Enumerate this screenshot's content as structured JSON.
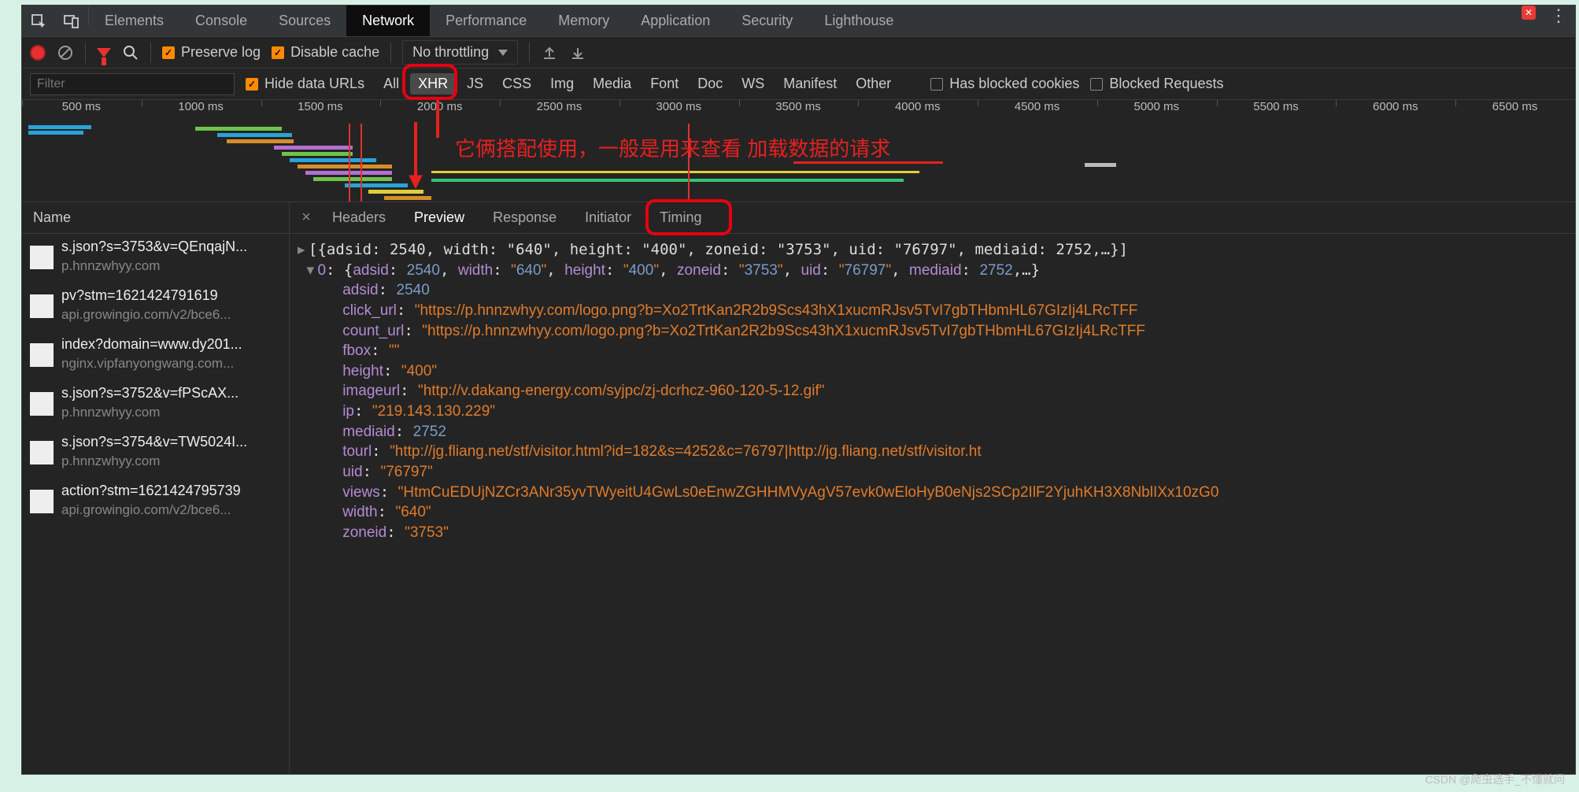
{
  "topTabs": [
    "Elements",
    "Console",
    "Sources",
    "Network",
    "Performance",
    "Memory",
    "Application",
    "Security",
    "Lighthouse"
  ],
  "topActive": "Network",
  "toolbar": {
    "preserve_log": "Preserve log",
    "disable_cache": "Disable cache",
    "throttling": "No throttling"
  },
  "filter": {
    "placeholder": "Filter",
    "hide_data_urls": "Hide data URLs",
    "types": [
      "All",
      "XHR",
      "JS",
      "CSS",
      "Img",
      "Media",
      "Font",
      "Doc",
      "WS",
      "Manifest",
      "Other"
    ],
    "selected_type": "XHR",
    "blocked_cookies": "Has blocked cookies",
    "blocked_requests": "Blocked Requests"
  },
  "timeline_marks": [
    "500 ms",
    "1000 ms",
    "1500 ms",
    "2000 ms",
    "2500 ms",
    "3000 ms",
    "3500 ms",
    "4000 ms",
    "4500 ms",
    "5000 ms",
    "5500 ms",
    "6000 ms",
    "6500 ms"
  ],
  "annotation": "它俩搭配使用，一般是用来查看    加载数据的请求",
  "left_header": "Name",
  "requests": [
    {
      "name": "s.json?s=3753&v=QEnqajN...",
      "host": "p.hnnzwhyy.com"
    },
    {
      "name": "pv?stm=1621424791619",
      "host": "api.growingio.com/v2/bce6..."
    },
    {
      "name": "index?domain=www.dy201...",
      "host": "nginx.vipfanyongwang.com..."
    },
    {
      "name": "s.json?s=3752&v=fPScAX...",
      "host": "p.hnnzwhyy.com"
    },
    {
      "name": "s.json?s=3754&v=TW5024I...",
      "host": "p.hnnzwhyy.com"
    },
    {
      "name": "action?stm=1621424795739",
      "host": "api.growingio.com/v2/bce6..."
    }
  ],
  "detailTabs": [
    "Headers",
    "Preview",
    "Response",
    "Initiator",
    "Timing"
  ],
  "detailActive": "Preview",
  "preview": {
    "header": "[{adsid: 2540, width: \"640\", height: \"400\", zoneid: \"3753\", uid: \"76797\", mediaid: 2752,…}]",
    "row0": "0: {adsid: 2540, width: \"640\", height: \"400\", zoneid: \"3753\", uid: \"76797\", mediaid: 2752,…}",
    "fields": {
      "adsid": "2540",
      "click_url": "\"https://p.hnnzwhyy.com/logo.png?b=Xo2TrtKan2R2b9Scs43hX1xucmRJsv5TvI7gbTHbmHL67GIzIj4LRcTFF",
      "count_url": "\"https://p.hnnzwhyy.com/logo.png?b=Xo2TrtKan2R2b9Scs43hX1xucmRJsv5TvI7gbTHbmHL67GIzIj4LRcTFF",
      "fbox": "\"\"",
      "height": "\"400\"",
      "imageurl": "\"http://v.dakang-energy.com/syjpc/zj-dcrhcz-960-120-5-12.gif\"",
      "ip": "\"219.143.130.229\"",
      "mediaid": "2752",
      "tourl": "\"http://jg.fliang.net/stf/visitor.html?id=182&s=4252&c=76797|http://jg.fliang.net/stf/visitor.ht",
      "uid": "\"76797\"",
      "views": "\"HtmCuEDUjNZCr3ANr35yvTWyeitU4GwLs0eEnwZGHHMVyAgV57evk0wEloHyB0eNjs2SCp2IlF2YjuhKH3X8NblIXx10zG0",
      "width": "\"640\"",
      "zoneid": "\"3753\""
    }
  },
  "watermark": "CSDN @爬虫选手_不懂就问"
}
